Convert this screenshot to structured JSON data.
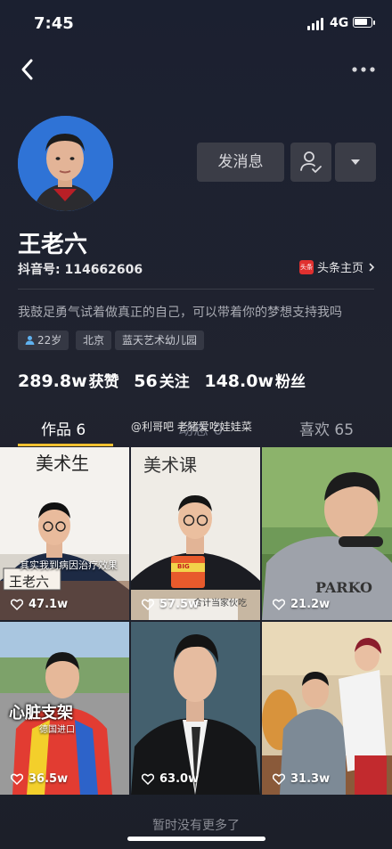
{
  "status": {
    "time": "7:45",
    "network": "4G"
  },
  "profile": {
    "name": "王老六",
    "douyin_id": "抖音号: 114662606",
    "toutiao_link": "头条主页",
    "toutiao_badge": "头条",
    "bio": "我鼓足勇气试着做真正的自己，可以带着你的梦想支持我吗",
    "tags": [
      "22岁",
      "北京",
      "蓝天艺术幼儿园"
    ]
  },
  "actions": {
    "message_label": "发消息"
  },
  "stats": {
    "likes_value": "289.8w",
    "likes_label": "获赞",
    "following_value": "56",
    "following_label": "关注",
    "fans_value": "148.0w",
    "fans_label": "粉丝"
  },
  "tabs": {
    "works": "作品 6",
    "middle": "动态 0",
    "likes": "喜欢 65"
  },
  "watermark": "@利哥吧 老猪爱吃娃娃菜",
  "videos": [
    {
      "likes": "47.1w",
      "board_text": "美术生",
      "caption": "其实我到病因治疗效果",
      "name_plate": "王老六"
    },
    {
      "likes": "57.5w",
      "board_text": "美术课",
      "cup_text": "BIG",
      "caption": "合计当家伙吃"
    },
    {
      "likes": "21.2w",
      "shirt_text": "PARKO"
    },
    {
      "likes": "36.5w",
      "caption": "心脏支架",
      "sub_caption": "德国进口"
    },
    {
      "likes": "63.0w"
    },
    {
      "likes": "31.3w"
    }
  ],
  "footer": {
    "no_more": "暂时没有更多了"
  },
  "colors": {
    "accent": "#f1c130",
    "button_bg": "#3b3d47",
    "toutiao_red": "#e0302f"
  }
}
